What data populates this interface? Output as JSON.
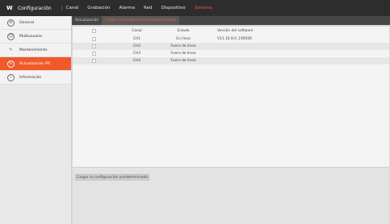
{
  "topbar": {
    "logo": "W",
    "app_title": "Configuración",
    "separator": "|",
    "menu": [
      "Canal",
      "Grabación",
      "Alarma",
      "Red",
      "Dispositivo",
      "Sistema"
    ],
    "active_menu": "Sistema",
    "accent_color": "#f05a28"
  },
  "sidebar": {
    "items": [
      {
        "label": "General",
        "icon": "gear-icon"
      },
      {
        "label": "Multiusuario",
        "icon": "users-icon"
      },
      {
        "label": "Mantenimiento",
        "icon": "wrench-icon"
      },
      {
        "label": "Actualización IPC",
        "icon": "update-icon"
      },
      {
        "label": "Información",
        "icon": "info-icon"
      }
    ],
    "active_index": 3
  },
  "subtabs": [
    {
      "label": "Actualización"
    },
    {
      "label": "Cargar la configuración predeterminada"
    }
  ],
  "active_subtab": 1,
  "table": {
    "headers": {
      "canal": "Canal",
      "estado": "Estado",
      "version": "Versión del software"
    },
    "rows": [
      {
        "canal": "CH1",
        "estado": "En línea",
        "version": "V11.16.8.0_190506"
      },
      {
        "canal": "CH2",
        "estado": "Fuera de línea",
        "version": ""
      },
      {
        "canal": "CH3",
        "estado": "Fuera de línea",
        "version": ""
      },
      {
        "canal": "CH4",
        "estado": "Fuera de línea",
        "version": ""
      }
    ]
  },
  "footer": {
    "load_default_label": "Cargar la configuración predeterminada"
  }
}
